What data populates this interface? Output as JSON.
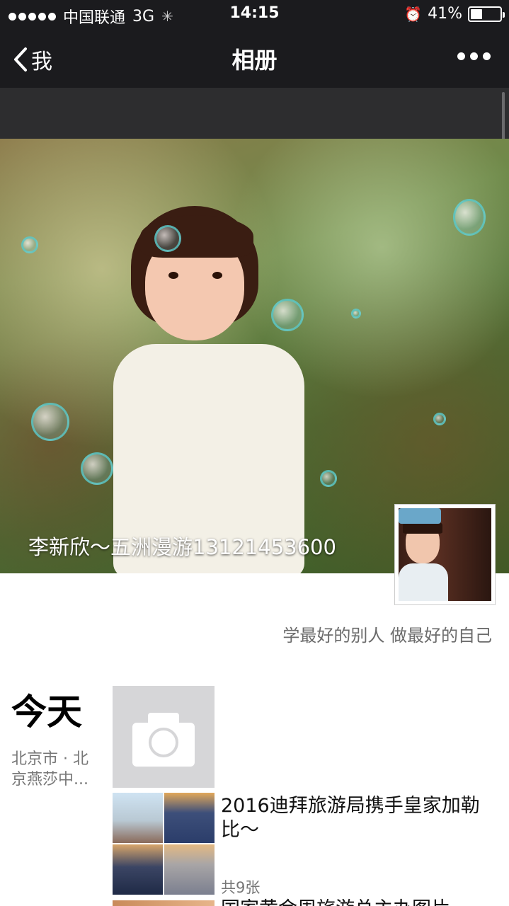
{
  "status_bar": {
    "carrier": "中国联通",
    "network": "3G",
    "time": "14:15",
    "battery_percent": "41%",
    "battery_level": 0.41
  },
  "nav": {
    "back_label": "我",
    "title": "相册"
  },
  "profile": {
    "cover_name": "李新欣～五洲漫游13121453600",
    "signature": "学最好的别人 做最好的自己"
  },
  "feed": {
    "day_label": "今天",
    "location": "北京市 · 北京燕莎中...",
    "posts": [
      {
        "title": "2016迪拜旅游局携手皇家加勒比～",
        "count": "共9张"
      },
      {
        "title": "国家黄金周旅游总主办图片"
      }
    ]
  },
  "colors": {
    "bar_bg": "#1b1b1e",
    "strip_bg": "#2d2d2f",
    "secondary_text": "#777777"
  }
}
